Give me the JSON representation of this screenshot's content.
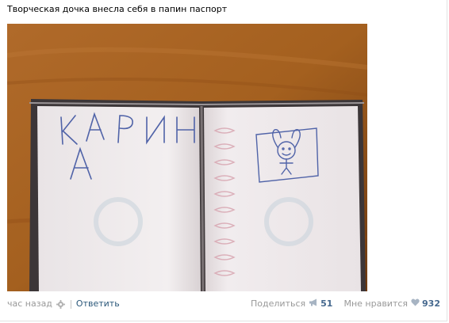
{
  "post": {
    "text": "Творческая дочка внесла себя в папин паспорт",
    "time": "час назад",
    "reply_label": "Ответить",
    "share_label": "Поделиться",
    "share_count": "51",
    "like_label": "Мне нравится",
    "like_count": "932",
    "photo_handwriting_line1": "КАРИН",
    "photo_handwriting_line2": "А"
  },
  "colors": {
    "link": "#2b587a",
    "count": "#45688e",
    "muted": "#999999",
    "table_wood": "#a8611f"
  },
  "icons": {
    "settings": "gear-icon",
    "share": "megaphone-icon",
    "like": "heart-icon"
  }
}
